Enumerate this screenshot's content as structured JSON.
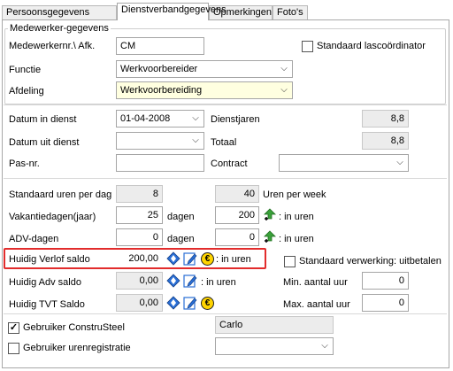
{
  "tabs": [
    "Persoonsgegevens",
    "Dienstverbandgegevens",
    "Opmerkingen",
    "Foto's"
  ],
  "employee_group": {
    "legend": "Medewerker-gegevens",
    "employee_no_label": "Medewerkernr.\\ Afk.",
    "employee_no_value": "CM",
    "standard_coordinator_label": "Standaard lascoördinator",
    "function_label": "Functie",
    "function_value": "Werkvoorbereider",
    "department_label": "Afdeling",
    "department_value": "Werkvoorbereiding"
  },
  "employment": {
    "start_date_label": "Datum in dienst",
    "start_date_value": "01-04-2008",
    "end_date_label": "Datum uit dienst",
    "end_date_value": "",
    "pass_no_label": "Pas-nr.",
    "pass_no_value": "",
    "service_years_label": "Dienstjaren",
    "service_years_value": "8,8",
    "total_label": "Totaal",
    "total_value": "8,8",
    "contract_label": "Contract",
    "contract_value": ""
  },
  "hours": {
    "std_hours_day_label": "Standaard uren per dag",
    "std_hours_day_value": "8",
    "hours_week_value": "40",
    "hours_week_label": "Uren per week",
    "vacation_days_label": "Vakantiedagen(jaar)",
    "vacation_days_value": "25",
    "days_unit": "dagen",
    "vacation_hours_value": "200",
    "in_hours_label": ": in uren",
    "adv_days_label": "ADV-dagen",
    "adv_days_value": "0",
    "adv_hours_value": "0"
  },
  "balances": {
    "leave_label": "Huidig Verlof saldo",
    "leave_value": "200,00",
    "leave_in_hours": ": in uren",
    "adv_label": "Huidig Adv saldo",
    "adv_value": "0,00",
    "adv_in_hours": ": in uren",
    "tvt_label": "Huidig TVT Saldo",
    "tvt_value": "0,00",
    "std_processing_label": "Standaard verwerking: uitbetalen",
    "min_hours_label": "Min. aantal uur",
    "min_hours_value": "0",
    "max_hours_label": "Max. aantal uur",
    "max_hours_value": "0"
  },
  "users": {
    "construsteel_label": "Gebruiker ConstruSteel",
    "construsteel_checked": true,
    "construsteel_user": "Carlo",
    "hours_reg_label": "Gebruiker urenregistratie",
    "hours_reg_checked": false,
    "hours_reg_value": ""
  },
  "colors": {
    "highlight_border": "#e22c2c",
    "yellow_field": "#ffffe0",
    "coin": "#ffd400",
    "arrow_green": "#3aa13a",
    "diamond_blue": "#2a6fd6"
  },
  "icons": [
    "check-icon",
    "chevron-down-icon",
    "arrow-up-plus-icon",
    "diamond-icon",
    "edit-icon",
    "euro-coin-icon"
  ]
}
